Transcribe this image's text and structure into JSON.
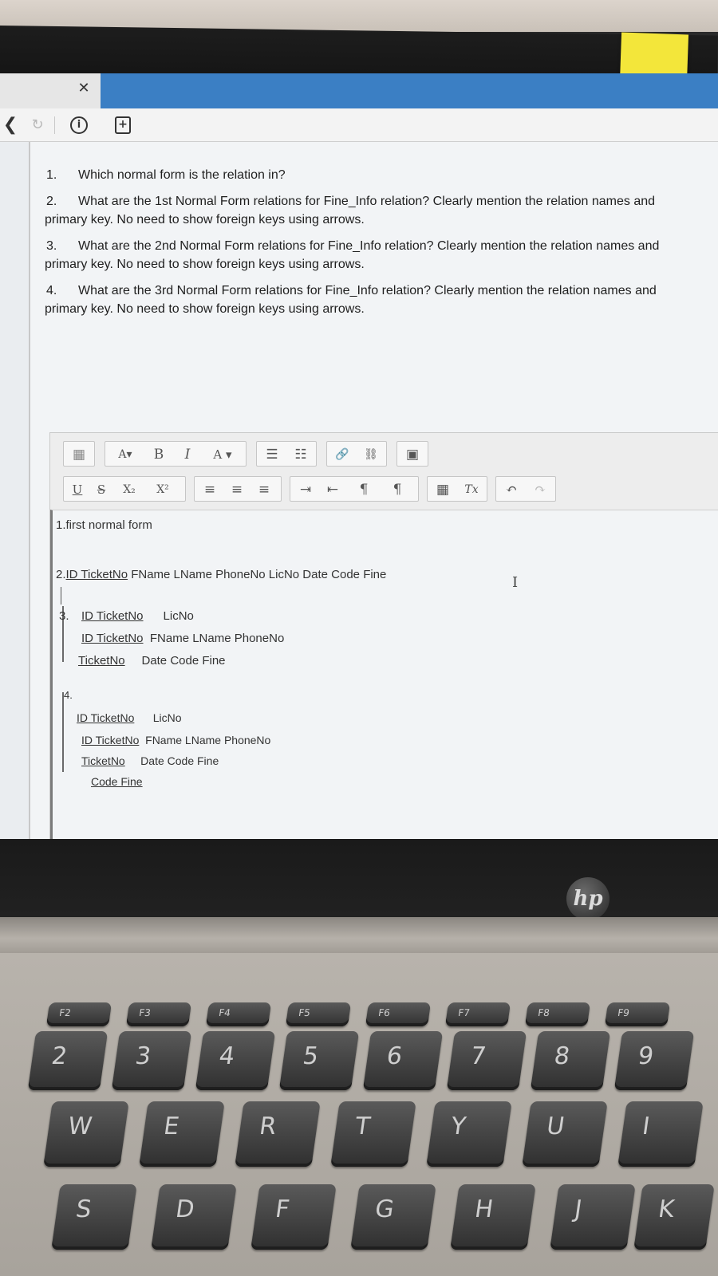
{
  "browser": {
    "close_glyph": "✕",
    "nav": {
      "back_glyph": "❮",
      "reload_glyph": "↻",
      "info_glyph": "i",
      "save_glyph": "+"
    }
  },
  "questions": [
    {
      "num": "1.",
      "text": "Which normal form is the relation in?"
    },
    {
      "num": "2.",
      "text": "What are the 1st Normal Form relations for Fine_Info relation? Clearly mention the relation names and",
      "cont": "primary key. No need to show foreign keys using arrows."
    },
    {
      "num": "3.",
      "text": "What are the 2nd Normal Form relations for Fine_Info relation? Clearly mention the relation names and",
      "cont": "primary key. No need to show foreign keys using arrows."
    },
    {
      "num": "4.",
      "text": "What are the 3rd Normal Form relations for Fine_Info relation? Clearly mention the relation names and",
      "cont": "primary key. No need to show foreign keys using arrows."
    }
  ],
  "toolbar": {
    "row1": [
      "▦",
      "A▾",
      "B",
      "I",
      "A ▾",
      "☰",
      "☷",
      "🔗",
      "⛓",
      "▣"
    ],
    "row2": [
      "U",
      "S",
      "X₂",
      "X²",
      "≡",
      "≡",
      "≡",
      "⇥",
      "⇤",
      "¶",
      "¶",
      "▦",
      "Tx",
      "↶",
      "↷"
    ]
  },
  "answer": {
    "line1": "1.first normal form",
    "line2_prefix": "2.",
    "line2_keys": "ID  TicketNo",
    "line2_rest": "  FName  LName  PhoneNo  LicNo  Date  Code  Fine",
    "s3_label": "3.",
    "s3_r1_keys": "ID   TicketNo",
    "s3_r1_rest": "LicNo",
    "s3_r2_keys": "ID TicketNo",
    "s3_r2_rest": "FName  LName  PhoneNo",
    "s3_r3_keys": "TicketNo",
    "s3_r3_rest": "Date  Code  Fine",
    "s4_label": "4.",
    "s4_r1_keys": "ID   TicketNo",
    "s4_r1_rest": "LicNo",
    "s4_r2_keys": "ID TicketNo",
    "s4_r2_rest": "FName  LName  PhoneNo",
    "s4_r3_keys": "TicketNo",
    "s4_r3_rest": "Date  Code  Fine",
    "s4_r4_keys": "Code  Fine",
    "cursor_glyph": "I"
  },
  "laptop": {
    "brand": "hp",
    "fn_keys": [
      "F2",
      "F3",
      "F4",
      "F5",
      "F6",
      "F7",
      "F8",
      "F9"
    ],
    "number_keys": [
      "2",
      "3",
      "4",
      "5",
      "6",
      "7",
      "8",
      "9"
    ],
    "letter_row1": [
      "W",
      "E",
      "R",
      "T",
      "Y",
      "U",
      "I"
    ],
    "letter_row2": [
      "S",
      "D",
      "F",
      "G",
      "H",
      "J",
      "K"
    ]
  }
}
